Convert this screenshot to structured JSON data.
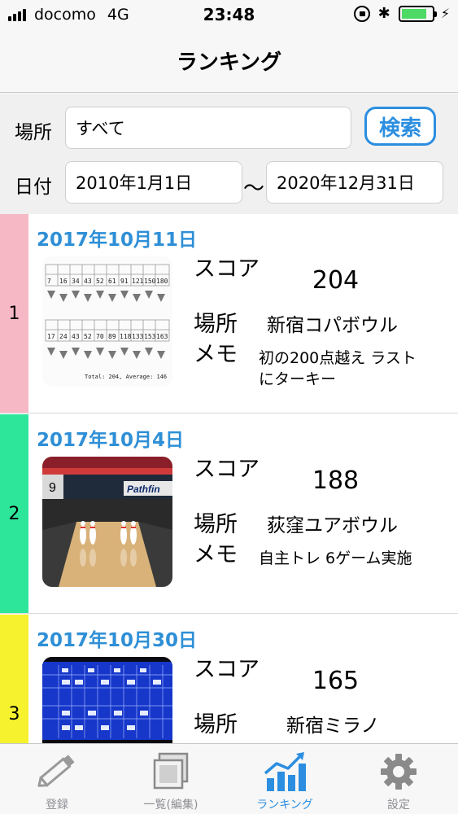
{
  "status_bar": {
    "carrier": "docomo",
    "network": "4G",
    "time": "23:48",
    "battery_level": 0.85
  },
  "nav": {
    "title": "ランキング"
  },
  "filter": {
    "place_label": "場所",
    "place_value": "すべて",
    "search_label": "検索",
    "date_label": "日付",
    "date_from": "2010年1月1日",
    "date_to": "2020年12月31日",
    "range_separator": "〜"
  },
  "labels": {
    "score": "スコア",
    "place": "場所",
    "memo": "メモ"
  },
  "rankings": [
    {
      "rank": "1",
      "date": "2017年10月11日",
      "score": "204",
      "place": "新宿コパボウル",
      "memo": "初の200点越え ラストにターキー",
      "rank_color": "#f7b8c6",
      "thumb": "score-sheet-photo",
      "sheet_frames": [
        "7",
        "16",
        "34",
        "43",
        "52",
        "61",
        "91",
        "121",
        "150",
        "180"
      ],
      "sheet_frames2": [
        "17",
        "24",
        "43",
        "52",
        "70",
        "89",
        "118",
        "133",
        "153",
        "163"
      ],
      "sheet_caption": "Total: 204, Average: 146"
    },
    {
      "rank": "2",
      "date": "2017年10月4日",
      "score": "188",
      "place": "荻窪ユアボウル",
      "memo": "自主トレ 6ゲーム実施",
      "rank_color": "#2de69a",
      "thumb": "bowling-lane-photo",
      "lane_number": "9",
      "lane_sign": "Pathfin"
    },
    {
      "rank": "3",
      "date": "2017年10月30日",
      "score": "165",
      "place": "新宿ミラノ",
      "memo": "",
      "rank_color": "#f7f22e",
      "thumb": "scoreboard-screen-photo"
    }
  ],
  "tabs": [
    {
      "label": "登録",
      "icon": "pencil-icon",
      "active": false
    },
    {
      "label": "一覧(編集)",
      "icon": "photo-stack-icon",
      "active": false
    },
    {
      "label": "ランキング",
      "icon": "chart-icon",
      "active": true
    },
    {
      "label": "設定",
      "icon": "gear-icon",
      "active": false
    }
  ],
  "colors": {
    "accent": "#2b8ee0",
    "date_blue": "#2f8fd6",
    "tab_inactive": "#8e8e93"
  }
}
